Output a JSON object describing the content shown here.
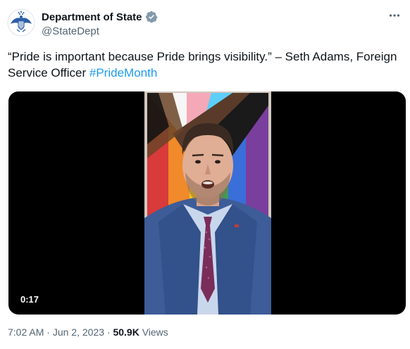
{
  "author": {
    "display_name": "Department of State",
    "handle": "@StateDept",
    "verified_badge_color": "#829aab",
    "avatar_icon": "great-seal-icon"
  },
  "more_icon": "more-options-icon",
  "tweet": {
    "text_main": "“Pride is important because Pride brings visibility.” – Seth Adams, Foreign Service Officer ",
    "hashtag": "#PrideMonth"
  },
  "video": {
    "duration": "0:17"
  },
  "meta": {
    "time": "7:02 AM",
    "separator": " · ",
    "date": "Jun 2, 2023",
    "views_count": "50.9K",
    "views_label": " Views"
  },
  "colors": {
    "text_primary": "#0f1419",
    "text_secondary": "#536471",
    "link": "#1d9bf0",
    "video_bg": "#000000"
  }
}
